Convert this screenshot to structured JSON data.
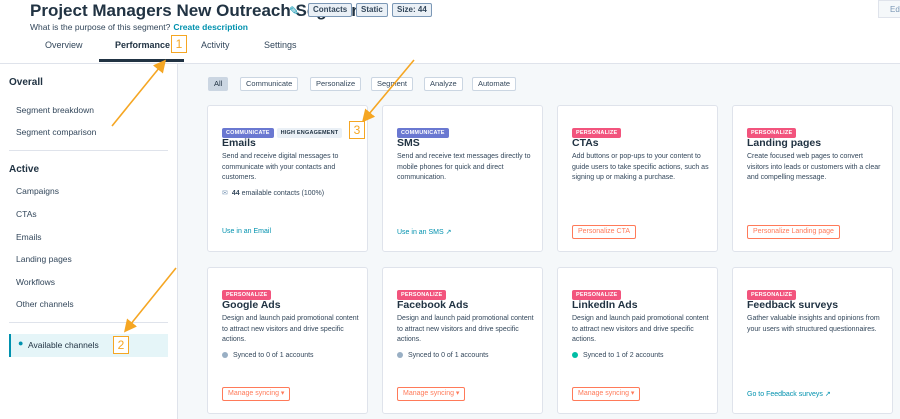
{
  "header": {
    "title": "Project Managers New Outreach Segment",
    "tags": [
      "Contacts",
      "Static",
      "Size: 44"
    ],
    "subtitle": "What is the purpose of this segment?",
    "subtitle_link": "Create description",
    "edit_label": "Ed"
  },
  "tabs": [
    "Overview",
    "Performance",
    "Activity",
    "Settings"
  ],
  "callouts": [
    "1",
    "2",
    "3"
  ],
  "sidebar": {
    "overall_heading": "Overall",
    "overall_items": [
      "Segment breakdown",
      "Segment comparison"
    ],
    "active_heading": "Active",
    "active_items": [
      "Campaigns",
      "CTAs",
      "Emails",
      "Landing pages",
      "Workflows",
      "Other channels"
    ],
    "available_label": "Available channels"
  },
  "filters": [
    "All",
    "Communicate",
    "Personalize",
    "Segment",
    "Analyze",
    "Automate"
  ],
  "cards": [
    {
      "badges": [
        "COMMUNICATE",
        "HIGH ENGAGEMENT"
      ],
      "title": "Emails",
      "desc": "Send and receive digital messages to communicate with your contacts and customers.",
      "stat_count": "44",
      "stat_text": "emailable contacts (100%)",
      "action": "Use in an Email"
    },
    {
      "badges": [
        "COMMUNICATE"
      ],
      "title": "SMS",
      "desc": "Send and receive text messages directly to mobile phones for quick and direct communication.",
      "action": "Use in an SMS"
    },
    {
      "badges": [
        "PERSONALIZE"
      ],
      "title": "CTAs",
      "desc": "Add buttons or pop-ups to your content to guide users to take specific actions, such as signing up or making a purchase.",
      "action": "Personalize CTA"
    },
    {
      "badges": [
        "PERSONALIZE"
      ],
      "title": "Landing pages",
      "desc": "Create focused web pages to convert visitors into leads or customers with a clear and compelling message.",
      "action": "Personalize Landing page"
    },
    {
      "badges": [
        "PERSONALIZE"
      ],
      "title": "Google Ads",
      "desc": "Design and launch paid promotional content to attract new visitors and drive specific actions.",
      "stat_text": "Synced to 0 of 1 accounts",
      "action": "Manage syncing ▾"
    },
    {
      "badges": [
        "PERSONALIZE"
      ],
      "title": "Facebook Ads",
      "desc": "Design and launch paid promotional content to attract new visitors and drive specific actions.",
      "stat_text": "Synced to 0 of 1 accounts",
      "action": "Manage syncing ▾"
    },
    {
      "badges": [
        "PERSONALIZE"
      ],
      "title": "LinkedIn Ads",
      "desc": "Design and launch paid promotional content to attract new visitors and drive specific actions.",
      "stat_text": "Synced to 1 of 2 accounts",
      "action": "Manage syncing ▾"
    },
    {
      "badges": [
        "PERSONALIZE"
      ],
      "title": "Feedback surveys",
      "desc": "Gather valuable insights and opinions from your users with structured questionnaires.",
      "action": "Go to Feedback surveys"
    }
  ],
  "colors": {
    "accent": "#0091ae",
    "communicate": "#6a78d1",
    "personalize": "#f2547d",
    "action": "#ff7a59",
    "annotation": "#f5a623",
    "synced": "#00bda5",
    "unsynced": "#99afc4"
  }
}
